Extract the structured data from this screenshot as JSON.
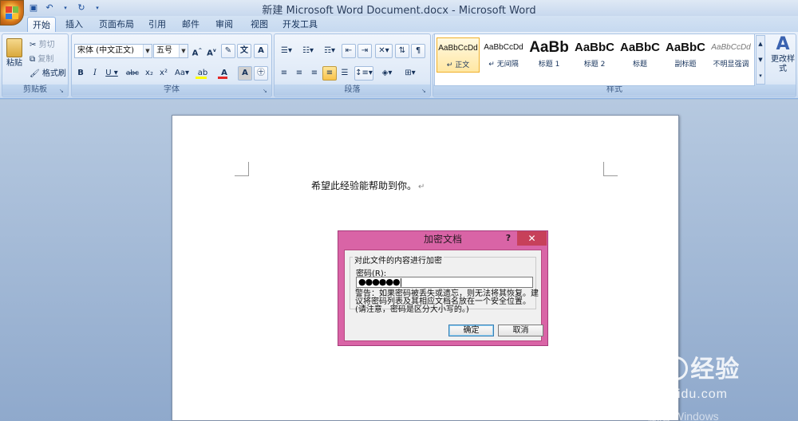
{
  "window": {
    "title": "新建 Microsoft Word Document.docx - Microsoft Word"
  },
  "quick_access": {
    "icons": [
      "save-icon",
      "undo-icon",
      "redo-icon",
      "customize-icon"
    ]
  },
  "tabs": [
    {
      "label": "开始",
      "active": true
    },
    {
      "label": "插入"
    },
    {
      "label": "页面布局"
    },
    {
      "label": "引用"
    },
    {
      "label": "邮件"
    },
    {
      "label": "审阅"
    },
    {
      "label": "视图"
    },
    {
      "label": "开发工具"
    }
  ],
  "ribbon": {
    "clipboard": {
      "group_label": "剪贴板",
      "paste": "粘贴",
      "cut": "剪切",
      "copy": "复制",
      "format_painter": "格式刷"
    },
    "font": {
      "group_label": "字体",
      "font_name": "宋体 (中文正文)",
      "font_size": "五号",
      "font_color": "#e32727",
      "highlight_color": "#ffff00"
    },
    "paragraph": {
      "group_label": "段落"
    },
    "styles": {
      "group_label": "样式",
      "items": [
        {
          "sample": "AaBbCcDd",
          "name": "正文",
          "selected": true
        },
        {
          "sample": "AaBbCcDd",
          "name": "无间隔"
        },
        {
          "sample": "AaBb",
          "name": "标题 1"
        },
        {
          "sample": "AaBbC",
          "name": "标题 2"
        },
        {
          "sample": "AaBbC",
          "name": "标题"
        },
        {
          "sample": "AaBbC",
          "name": "副标题"
        },
        {
          "sample": "AaBbCcDd",
          "name": "不明显强调"
        }
      ],
      "change_styles": "更改样式"
    }
  },
  "document": {
    "text": "希望此经验能帮助到你。",
    "para_mark": "↵"
  },
  "dialog": {
    "title": "加密文档",
    "help": "?",
    "close": "✕",
    "section": "对此文件的内容进行加密",
    "password_label": "密码(R):",
    "password_value": "●●●●●●",
    "warning": "警告：如果密码被丢失或遗忘，则无法将其恢复。建议将密码列表及其相应文档名放在一个安全位置。(请注意，密码是区分大小写的。)",
    "ok": "确定",
    "cancel": "取消",
    "accent": "#d964a6"
  },
  "watermark": {
    "baidu": "Bai",
    "jingyan": "经验",
    "url": "jingyan.baidu.com",
    "windows": "激活 Windows"
  }
}
